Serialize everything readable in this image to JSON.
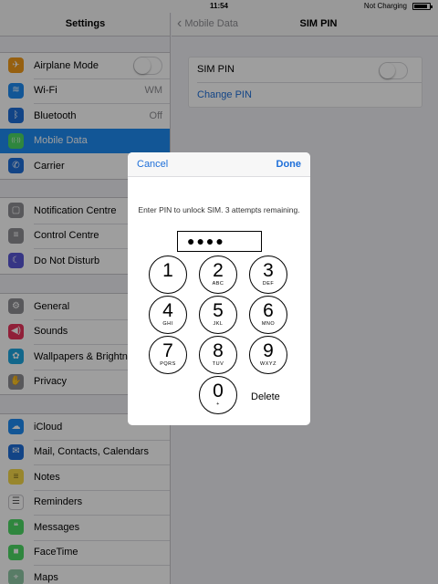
{
  "status_bar": {
    "time": "11:54",
    "charging": "Not Charging",
    "battery_level": 0.9
  },
  "sidebar": {
    "title": "Settings",
    "groups": [
      {
        "items": [
          {
            "label": "Airplane Mode",
            "icon": "airplane-icon",
            "color": "#f29b1b",
            "glyph": "✈",
            "toggle": false
          },
          {
            "label": "Wi-Fi",
            "icon": "wifi-icon",
            "color": "#1e8bf2",
            "glyph": "≋",
            "value": "WM"
          },
          {
            "label": "Bluetooth",
            "icon": "bluetooth-icon",
            "color": "#1e6fd9",
            "glyph": "ᛒ",
            "value": "Off"
          },
          {
            "label": "Mobile Data",
            "icon": "antenna-icon",
            "color": "#4cd964",
            "glyph": "((·))",
            "selected": true
          },
          {
            "label": "Carrier",
            "icon": "phone-icon",
            "color": "#1e6fd9",
            "glyph": "✆"
          }
        ]
      },
      {
        "items": [
          {
            "label": "Notification Centre",
            "icon": "notification-icon",
            "color": "#8e8e93",
            "glyph": "▢"
          },
          {
            "label": "Control Centre",
            "icon": "switches-icon",
            "color": "#8e8e93",
            "glyph": "≡"
          },
          {
            "label": "Do Not Disturb",
            "icon": "moon-icon",
            "color": "#5856d6",
            "glyph": "☾"
          }
        ]
      },
      {
        "items": [
          {
            "label": "General",
            "icon": "gear-icon",
            "color": "#8e8e93",
            "glyph": "⚙"
          },
          {
            "label": "Sounds",
            "icon": "speaker-icon",
            "color": "#e8335b",
            "glyph": "◀)"
          },
          {
            "label": "Wallpapers & Brightness",
            "icon": "flower-icon",
            "color": "#1ea7e1",
            "glyph": "✿"
          },
          {
            "label": "Privacy",
            "icon": "hand-icon",
            "color": "#8e8e93",
            "glyph": "✋"
          }
        ]
      },
      {
        "items": [
          {
            "label": "iCloud",
            "icon": "cloud-icon",
            "color": "#1e8bf2",
            "glyph": "☁"
          },
          {
            "label": "Mail, Contacts, Calendars",
            "icon": "mail-icon",
            "color": "#1e6fd9",
            "glyph": "✉"
          },
          {
            "label": "Notes",
            "icon": "notes-icon",
            "color": "#f5d84a",
            "glyph": "≡"
          },
          {
            "label": "Reminders",
            "icon": "reminders-icon",
            "color": "#ffffff",
            "glyph": "☰"
          },
          {
            "label": "Messages",
            "icon": "speech-bubble-icon",
            "color": "#4cd964",
            "glyph": "❝"
          },
          {
            "label": "FaceTime",
            "icon": "video-camera-icon",
            "color": "#4cd964",
            "glyph": "■"
          },
          {
            "label": "Maps",
            "icon": "map-icon",
            "color": "#8fc9a5",
            "glyph": "⌖"
          }
        ]
      }
    ]
  },
  "detail": {
    "back_label": "Mobile Data",
    "title": "SIM PIN",
    "sim_pin_label": "SIM PIN",
    "sim_pin_enabled": false,
    "change_pin_label": "Change PIN"
  },
  "modal": {
    "cancel_label": "Cancel",
    "done_label": "Done",
    "prompt": "Enter PIN to unlock SIM. 3 attempts remaining.",
    "pin_value": "●●●●",
    "keys": [
      {
        "num": "1",
        "letters": ""
      },
      {
        "num": "2",
        "letters": "ABC"
      },
      {
        "num": "3",
        "letters": "DEF"
      },
      {
        "num": "4",
        "letters": "GHI"
      },
      {
        "num": "5",
        "letters": "JKL"
      },
      {
        "num": "6",
        "letters": "MNO"
      },
      {
        "num": "7",
        "letters": "PQRS"
      },
      {
        "num": "8",
        "letters": "TUV"
      },
      {
        "num": "9",
        "letters": "WXYZ"
      },
      {
        "num": "0",
        "letters": "+"
      }
    ],
    "delete_label": "Delete"
  },
  "colors": {
    "accent": "#1e6fd9",
    "selected_row": "#1e8bf2"
  }
}
